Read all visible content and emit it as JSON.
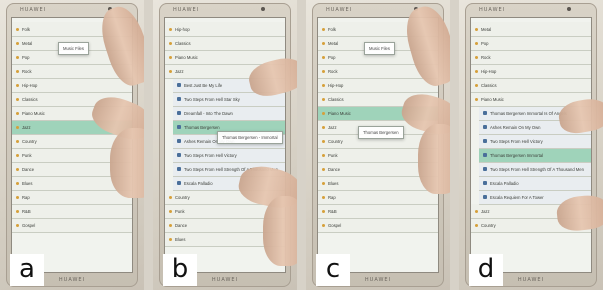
{
  "brand": "HUAWEI",
  "panels": [
    {
      "label": "a",
      "floating": "Music Files",
      "rows": [
        {
          "text": "Folk",
          "kind": "folder"
        },
        {
          "text": "Metal",
          "kind": "folder"
        },
        {
          "text": "Pop",
          "kind": "folder"
        },
        {
          "text": "Rock",
          "kind": "folder"
        },
        {
          "text": "Hip-Hop",
          "kind": "folder"
        },
        {
          "text": "Classics",
          "kind": "folder"
        },
        {
          "text": "Piano Music",
          "kind": "folder"
        },
        {
          "text": "Jazz",
          "kind": "folder",
          "highlight": true
        },
        {
          "text": "Country",
          "kind": "folder"
        },
        {
          "text": "Punk",
          "kind": "folder"
        },
        {
          "text": "Dance",
          "kind": "folder"
        },
        {
          "text": "Blues",
          "kind": "folder"
        },
        {
          "text": "Rap",
          "kind": "folder"
        },
        {
          "text": "R&B",
          "kind": "folder"
        },
        {
          "text": "Gospel",
          "kind": "folder"
        }
      ]
    },
    {
      "label": "b",
      "floating": "Thomas Bergersen - Immortal",
      "rows": [
        {
          "text": "Hip-hop",
          "kind": "folder"
        },
        {
          "text": "Classics",
          "kind": "folder"
        },
        {
          "text": "Piano Music",
          "kind": "folder"
        },
        {
          "text": "Jazz",
          "kind": "folder"
        },
        {
          "text": "Best Just Be My Life",
          "kind": "file",
          "indent": true
        },
        {
          "text": "Two Steps From Hell Star Sky",
          "kind": "file",
          "indent": true
        },
        {
          "text": "Dreamfall - Into The Dawn",
          "kind": "file",
          "indent": true
        },
        {
          "text": "Thomas Bergersen",
          "kind": "file",
          "indent": true,
          "highlight": true
        },
        {
          "text": "Ashes Remain On My Own",
          "kind": "file",
          "indent": true
        },
        {
          "text": "Two Steps From Hell Victory",
          "kind": "file",
          "indent": true
        },
        {
          "text": "Two Steps From Hell Strength Of A Thousand Men",
          "kind": "file",
          "indent": true
        },
        {
          "text": "Escala Palladio",
          "kind": "file",
          "indent": true
        },
        {
          "text": "Country",
          "kind": "folder"
        },
        {
          "text": "Punk",
          "kind": "folder"
        },
        {
          "text": "Dance",
          "kind": "folder"
        },
        {
          "text": "Blues",
          "kind": "folder"
        }
      ]
    },
    {
      "label": "c",
      "floating": "Thomas Bergersen",
      "floating2": "Music Files",
      "rows": [
        {
          "text": "Folk",
          "kind": "folder"
        },
        {
          "text": "Metal",
          "kind": "folder"
        },
        {
          "text": "Pop",
          "kind": "folder"
        },
        {
          "text": "Rock",
          "kind": "folder"
        },
        {
          "text": "Hip-Hop",
          "kind": "folder"
        },
        {
          "text": "Classics",
          "kind": "folder"
        },
        {
          "text": "Piano Music",
          "kind": "folder",
          "highlight": true
        },
        {
          "text": "Jazz",
          "kind": "folder"
        },
        {
          "text": "Country",
          "kind": "folder"
        },
        {
          "text": "Punk",
          "kind": "folder"
        },
        {
          "text": "Dance",
          "kind": "folder"
        },
        {
          "text": "Blues",
          "kind": "folder"
        },
        {
          "text": "Rap",
          "kind": "folder"
        },
        {
          "text": "R&B",
          "kind": "folder"
        },
        {
          "text": "Gospel",
          "kind": "folder"
        }
      ]
    },
    {
      "label": "d",
      "rows": [
        {
          "text": "Metal",
          "kind": "folder"
        },
        {
          "text": "Pop",
          "kind": "folder"
        },
        {
          "text": "Rock",
          "kind": "folder"
        },
        {
          "text": "Hip-Hop",
          "kind": "folder"
        },
        {
          "text": "Classics",
          "kind": "folder"
        },
        {
          "text": "Piano Music",
          "kind": "folder"
        },
        {
          "text": "Thomas Bergersen Immortal Is Of Angels",
          "kind": "file",
          "indent": true
        },
        {
          "text": "Ashes Remain On My Own",
          "kind": "file",
          "indent": true
        },
        {
          "text": "Two Steps From Hell Victory",
          "kind": "file",
          "indent": true
        },
        {
          "text": "Thomas Bergersen Immortal",
          "kind": "file",
          "indent": true,
          "highlight": true
        },
        {
          "text": "Two Steps From Hell Strength Of A Thousand Men",
          "kind": "file",
          "indent": true
        },
        {
          "text": "Escala Palladio",
          "kind": "file",
          "indent": true
        },
        {
          "text": "Escala Requiem For A Tower",
          "kind": "file",
          "indent": true
        },
        {
          "text": "Jazz",
          "kind": "folder"
        },
        {
          "text": "Country",
          "kind": "folder"
        }
      ]
    }
  ],
  "colors": {
    "highlight": "#9fd3ba",
    "folder_icon": "#d49a2b",
    "file_icon": "#4a6f9a",
    "screen": "#f1f3ee"
  }
}
